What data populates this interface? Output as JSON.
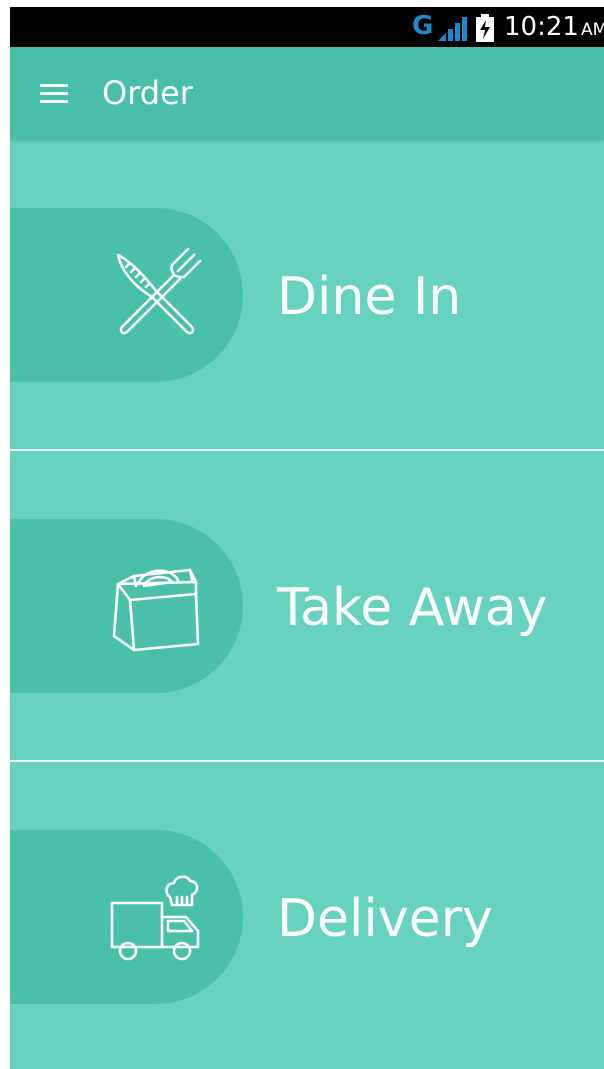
{
  "status_bar": {
    "network_type": "G",
    "signal_icon": "signal-bars-icon",
    "battery_icon": "battery-charging-icon",
    "time": "10:21",
    "ampm": "AM",
    "network_color": "#1e88c8"
  },
  "app_bar": {
    "menu_icon": "hamburger-menu-icon",
    "title": "Order",
    "background": "#49bea8"
  },
  "options": [
    {
      "label": "Dine In",
      "icon": "fork-knife-icon"
    },
    {
      "label": "Take Away",
      "icon": "takeaway-box-icon"
    },
    {
      "label": "Delivery",
      "icon": "delivery-truck-icon"
    }
  ],
  "colors": {
    "background": "#67d2bd",
    "pill": "#4ac0a9",
    "text": "#ffffff"
  }
}
